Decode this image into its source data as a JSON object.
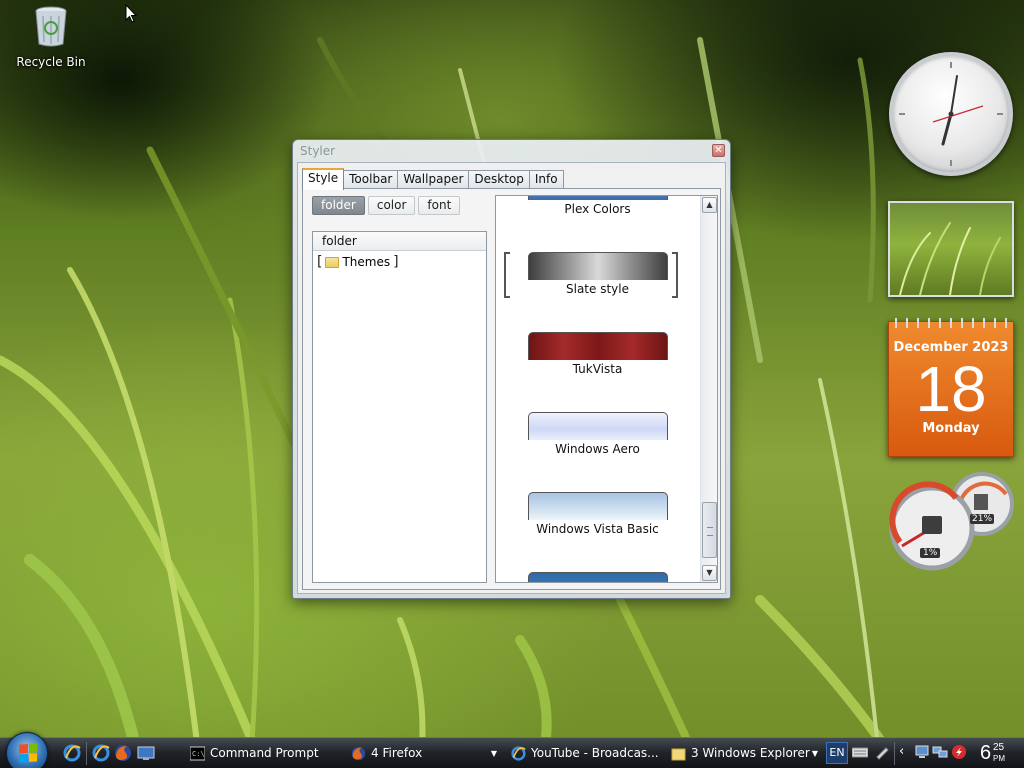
{
  "desktop": {
    "recycle_bin_label": "Recycle Bin"
  },
  "styler": {
    "title": "Styler",
    "tabs": [
      "Style",
      "Toolbar",
      "Wallpaper",
      "Desktop",
      "Info"
    ],
    "active_tab": "Style",
    "sub_buttons": [
      "folder",
      "color",
      "font"
    ],
    "selected_sub": "folder",
    "tree_header": "folder",
    "tree_item": "Themes",
    "styles": [
      {
        "name": "Plex Colors",
        "color": "#3b6aa8"
      },
      {
        "name": "Slate style",
        "color": "#5a5a5a",
        "selected": true
      },
      {
        "name": "TukVista",
        "color": "#8a1c1c"
      },
      {
        "name": "Windows Aero",
        "color": "#dfe6f7"
      },
      {
        "name": "Windows Vista Basic",
        "color": "#b7cfe6"
      }
    ]
  },
  "gadgets": {
    "calendar": {
      "month": "December 2023",
      "day": "18",
      "weekday": "Monday"
    },
    "meters": {
      "cpu": "1%",
      "memory": "21%"
    }
  },
  "taskbar": {
    "items": [
      {
        "label": "Command Prompt"
      },
      {
        "label": "4 Firefox"
      },
      {
        "label": "YouTube - Broadcas..."
      },
      {
        "label": "3 Windows Explorer"
      }
    ],
    "language": "EN",
    "time": {
      "hour": "6",
      "minutes": "25",
      "ampm": "PM"
    }
  }
}
